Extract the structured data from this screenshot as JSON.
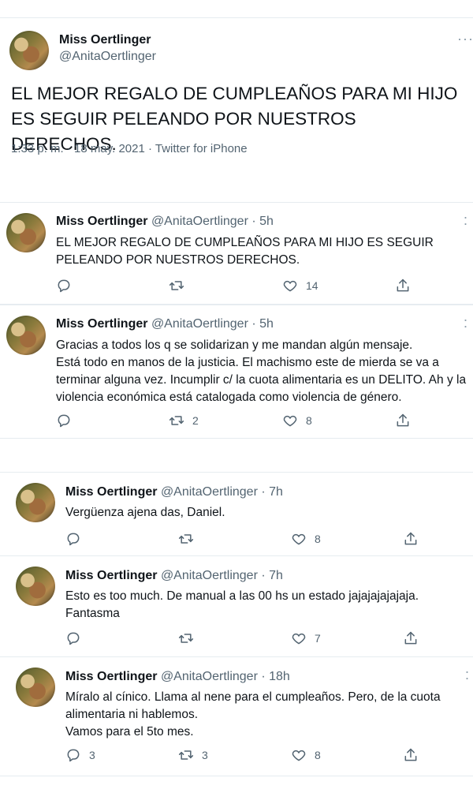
{
  "main_tweet": {
    "author_name": "Miss Oertlinger",
    "author_handle": "@AnitaOertlinger",
    "text": "EL MEJOR REGALO DE CUMPLEAÑOS PARA MI HIJO ES SEGUIR PELEANDO POR NUESTROS DERECHOS.",
    "meta": "1:33 p. m. · 18 may. 2021 · Twitter for iPhone",
    "more": "···"
  },
  "tweets": [
    {
      "author_name": "Miss Oertlinger",
      "handle_time": "@AnitaOertlinger · 5h",
      "text": "EL MEJOR REGALO DE CUMPLEAÑOS PARA MI HIJO ES SEGUIR PELEANDO POR NUESTROS DERECHOS.",
      "reply_count": "",
      "retweet_count": "",
      "like_count": "14"
    },
    {
      "author_name": "Miss Oertlinger",
      "handle_time": "@AnitaOertlinger · 5h",
      "text": "Gracias a todos los q se solidarizan y me mandan algún mensaje.\nEstá todo en manos de la justicia. El machismo este de mierda se va a terminar alguna vez. Incumplir c/ la cuota alimentaria es un DELITO. Ah y la violencia económica está catalogada como violencia de género.",
      "reply_count": "",
      "retweet_count": "2",
      "like_count": "8"
    },
    {
      "author_name": "Miss Oertlinger",
      "handle_time": "@AnitaOertlinger · 7h",
      "text": "Vergüenza ajena das, Daniel.",
      "reply_count": "",
      "retweet_count": "",
      "like_count": "8"
    },
    {
      "author_name": "Miss Oertlinger",
      "handle_time": "@AnitaOertlinger · 7h",
      "text": "Esto es too much. De manual a las 00 hs un estado jajajajajajaja.\nFantasma",
      "reply_count": "",
      "retweet_count": "",
      "like_count": "7"
    },
    {
      "author_name": "Miss Oertlinger",
      "handle_time": "@AnitaOertlinger · 18h",
      "text": "Míralo al cínico. Llama al nene para el cumpleaños. Pero, de la cuota alimentaria ni hablemos.\nVamos para el 5to mes.",
      "reply_count": "3",
      "retweet_count": "3",
      "like_count": "8"
    }
  ],
  "icons": {
    "reply": "reply-icon",
    "retweet": "retweet-icon",
    "like": "heart-icon",
    "share": "share-icon",
    "more": "more-icon"
  },
  "colors": {
    "text": "#0f1419",
    "secondary": "#536471",
    "divider": "#e6ecf0"
  }
}
